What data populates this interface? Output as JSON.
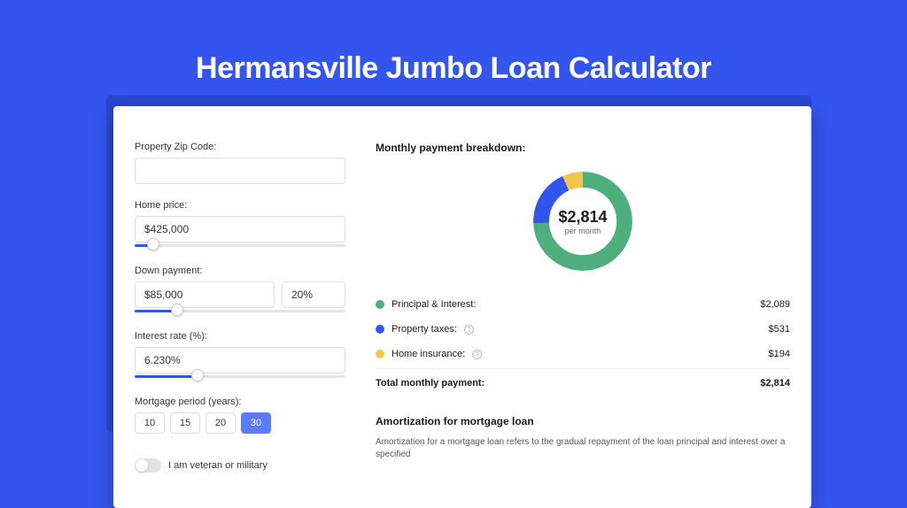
{
  "title": "Hermansville Jumbo Loan Calculator",
  "form": {
    "zip_label": "Property Zip Code:",
    "zip_value": "",
    "price_label": "Home price:",
    "price_value": "$425,000",
    "price_slider_pct": 9,
    "down_label": "Down payment:",
    "down_value": "$85,000",
    "down_pct_value": "20%",
    "down_slider_pct": 20,
    "rate_label": "Interest rate (%):",
    "rate_value": "6.230%",
    "rate_slider_pct": 30,
    "period_label": "Mortgage period (years):",
    "periods": [
      "10",
      "15",
      "20",
      "30"
    ],
    "period_selected": "30",
    "veteran_label": "I am veteran or military"
  },
  "breakdown": {
    "heading": "Monthly payment breakdown:",
    "center_amount": "$2,814",
    "center_sub": "per month",
    "items": [
      {
        "label": "Principal & Interest:",
        "value": "$2,089",
        "color": "green",
        "pct": 74.2
      },
      {
        "label": "Property taxes:",
        "value": "$531",
        "color": "blue",
        "pct": 18.9,
        "info": true
      },
      {
        "label": "Home insurance:",
        "value": "$194",
        "color": "yellow",
        "pct": 6.9,
        "info": true
      }
    ],
    "total_label": "Total monthly payment:",
    "total_value": "$2,814"
  },
  "amort": {
    "heading": "Amortization for mortgage loan",
    "text": "Amortization for a mortgage loan refers to the gradual repayment of the loan principal and interest over a specified"
  },
  "chart_data": {
    "type": "pie",
    "title": "Monthly payment breakdown",
    "series": [
      {
        "name": "Principal & Interest",
        "value": 2089
      },
      {
        "name": "Property taxes",
        "value": 531
      },
      {
        "name": "Home insurance",
        "value": 194
      }
    ],
    "total": 2814,
    "center_label": "$2,814 per month"
  }
}
